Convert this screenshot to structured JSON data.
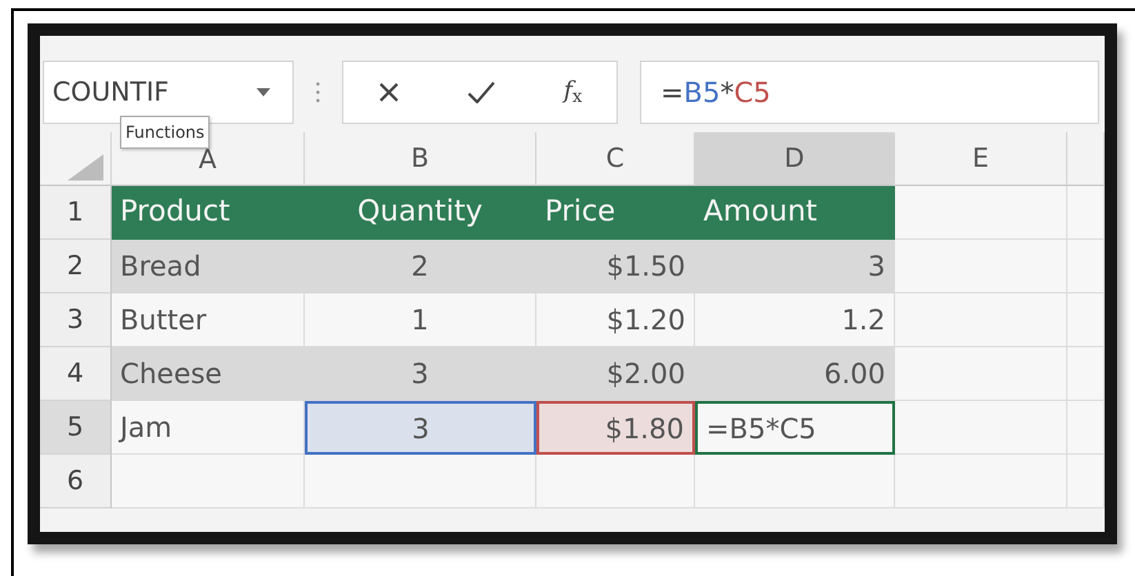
{
  "name_box": {
    "value": "COUNTIF"
  },
  "tooltip": "Functions",
  "formula_bar": {
    "fx": "*f*$_{x}$",
    "segments": [
      {
        "text": "="
      },
      {
        "text": "B5",
        "color": "#4472c4"
      },
      {
        "text": "*"
      },
      {
        "text": "C5",
        "color": "#c0504d"
      }
    ]
  },
  "columns": [
    {
      "label": "A",
      "selected": false
    },
    {
      "label": "B",
      "selected": false
    },
    {
      "label": "C",
      "selected": false
    },
    {
      "label": "D",
      "selected": true
    },
    {
      "label": "E",
      "selected": false
    }
  ],
  "rows": [
    {
      "number": "1",
      "kind": "header",
      "selected": false,
      "cells": [
        {
          "text": "Product"
        },
        {
          "text": "Quantity"
        },
        {
          "text": "Price"
        },
        {
          "text": "Amount"
        }
      ]
    },
    {
      "number": "2",
      "kind": "data",
      "striped": true,
      "selected": false,
      "cells": [
        {
          "text": "Bread"
        },
        {
          "text": "2"
        },
        {
          "text": "$1.50"
        },
        {
          "text": "3"
        }
      ]
    },
    {
      "number": "3",
      "kind": "data",
      "striped": false,
      "selected": false,
      "cells": [
        {
          "text": "Butter"
        },
        {
          "text": "1"
        },
        {
          "text": "$1.20"
        },
        {
          "text": "1.2"
        }
      ]
    },
    {
      "number": "4",
      "kind": "data",
      "striped": true,
      "selected": false,
      "cells": [
        {
          "text": "Cheese"
        },
        {
          "text": "3"
        },
        {
          "text": "$2.00"
        },
        {
          "text": "6.00"
        }
      ]
    },
    {
      "number": "5",
      "kind": "data",
      "striped": false,
      "selected": true,
      "cells": [
        {
          "text": "Jam"
        },
        {
          "text": "3",
          "color": "#4472c4"
        },
        {
          "text": "$1.80",
          "color": "#c0504d"
        },
        {
          "text": "=B5*C5",
          "active": true
        }
      ]
    },
    {
      "number": "6",
      "kind": "empty",
      "selected": false,
      "cells": []
    }
  ]
}
